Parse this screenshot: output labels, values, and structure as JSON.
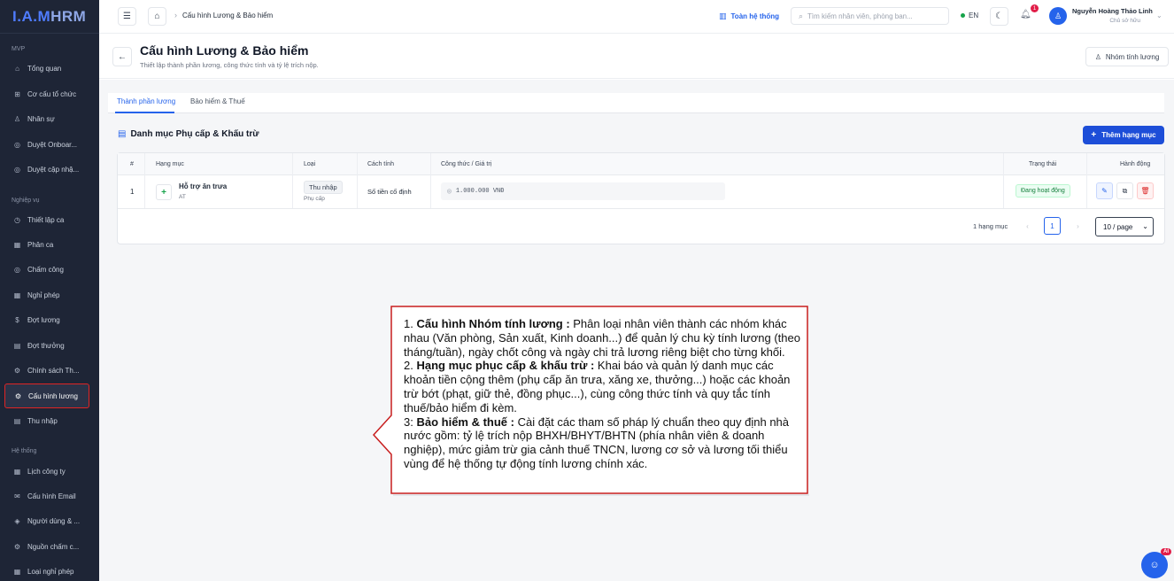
{
  "app": {
    "logo_part1": "I.A.M",
    "logo_part2": "HRM"
  },
  "sidebar": {
    "section_mvp": "MVP",
    "section_business": "Nghiệp vụ",
    "section_system": "Hệ thống",
    "items": [
      {
        "label": "Tổng quan",
        "icon": "dashboard-icon"
      },
      {
        "label": "Cơ cấu tổ chức",
        "icon": "org-chart-icon"
      },
      {
        "label": "Nhân sự",
        "icon": "users-icon"
      },
      {
        "label": "Duyệt Onboar...",
        "icon": "check-circle-icon"
      },
      {
        "label": "Duyệt cập nhậ...",
        "icon": "check-circle-icon"
      },
      {
        "label": "Thiết lập ca",
        "icon": "clock-icon"
      },
      {
        "label": "Phân ca",
        "icon": "calendar-icon"
      },
      {
        "label": "Chấm công",
        "icon": "check-circle-icon"
      },
      {
        "label": "Nghỉ phép",
        "icon": "calendar-icon"
      },
      {
        "label": "Đợt lương",
        "icon": "dollar-icon"
      },
      {
        "label": "Đợt thưởng",
        "icon": "document-icon"
      },
      {
        "label": "Chính sách Th...",
        "icon": "gear-icon"
      },
      {
        "label": "Cấu hình lương",
        "icon": "gear-icon"
      },
      {
        "label": "Thu nhập",
        "icon": "document-icon"
      },
      {
        "label": "Lịch công ty",
        "icon": "calendar-icon"
      },
      {
        "label": "Cấu hình Email",
        "icon": "mail-icon"
      },
      {
        "label": "Người dùng & ...",
        "icon": "shield-icon"
      },
      {
        "label": "Nguồn chấm c...",
        "icon": "gear-icon"
      },
      {
        "label": "Loại nghỉ phép",
        "icon": "calendar-icon"
      }
    ]
  },
  "topbar": {
    "breadcrumb": "Cấu hình Lương & Bảo hiểm",
    "system_link": "Toàn hệ thống",
    "search_placeholder": "Tìm kiếm nhân viên, phòng ban...",
    "language": "EN",
    "notification_count": "1",
    "user_name": "Nguyễn Hoàng Thảo Linh",
    "user_role": "Chủ sở hữu"
  },
  "page": {
    "title": "Cấu hình Lương & Bảo hiểm",
    "subtitle": "Thiết lập thành phần lương, công thức tính và tỷ lệ trích nộp.",
    "group_button": "Nhóm tính lương"
  },
  "tabs": [
    {
      "label": "Thành phần lương",
      "active": true
    },
    {
      "label": "Bảo hiểm & Thuế",
      "active": false
    }
  ],
  "section": {
    "title": "Danh mục Phụ cấp & Khấu trừ",
    "add_button": "Thêm hạng mục"
  },
  "table": {
    "headers": [
      "#",
      "Hạng mục",
      "Loại",
      "Cách tính",
      "Công thức / Giá trị",
      "Trạng thái",
      "Hành động"
    ],
    "rows": [
      {
        "index": "1",
        "name": "Hỗ trợ ăn trưa",
        "code": "AT",
        "type_tag": "Thu nhập",
        "type_sub": "Phụ cấp",
        "method": "Số tiền cố định",
        "value": "1.000.000 VNĐ",
        "status": "Đang hoạt động"
      }
    ],
    "total_label": "1 hạng mục",
    "current_page": "1",
    "page_size": "10 / page"
  },
  "callout": {
    "p1_num": "1. ",
    "p1_bold": "Cấu hình Nhóm tính lương : ",
    "p1_text": "Phân loại nhân viên thành các nhóm khác nhau (Văn phòng, Sản xuất, Kinh doanh...) để quản lý chu kỳ tính lương (theo tháng/tuần), ngày chốt công và ngày chi trả lương riêng biệt cho từng khối.",
    "p2_num": "2. ",
    "p2_bold": "Hạng mục phục cấp & khấu trừ : ",
    "p2_text": "Khai báo và quản lý danh mục các khoản tiền cộng thêm (phụ cấp ăn trưa, xăng xe, thưởng...) hoặc các khoản trừ bớt (phạt, giữ thẻ, đồng phục...), cùng công thức tính và quy tắc tính thuế/bảo hiểm đi kèm.",
    "p3_num": "3: ",
    "p3_bold": "Bảo hiểm & thuế : ",
    "p3_text": "Cài đặt các tham số pháp lý chuẩn theo quy định nhà nước gồm: tỷ lệ trích nộp BHXH/BHYT/BHTN (phía nhân viên & doanh nghiệp), mức giảm trừ gia cảnh thuế TNCN, lương cơ sở và lương tối thiểu vùng để hệ thống tự động tính lương chính xác."
  },
  "fab": {
    "badge": "AI"
  },
  "colors": {
    "sidebar_bg": "#1e2536",
    "accent": "#2563eb",
    "highlight_border": "#e02424",
    "success": "#15803d"
  }
}
